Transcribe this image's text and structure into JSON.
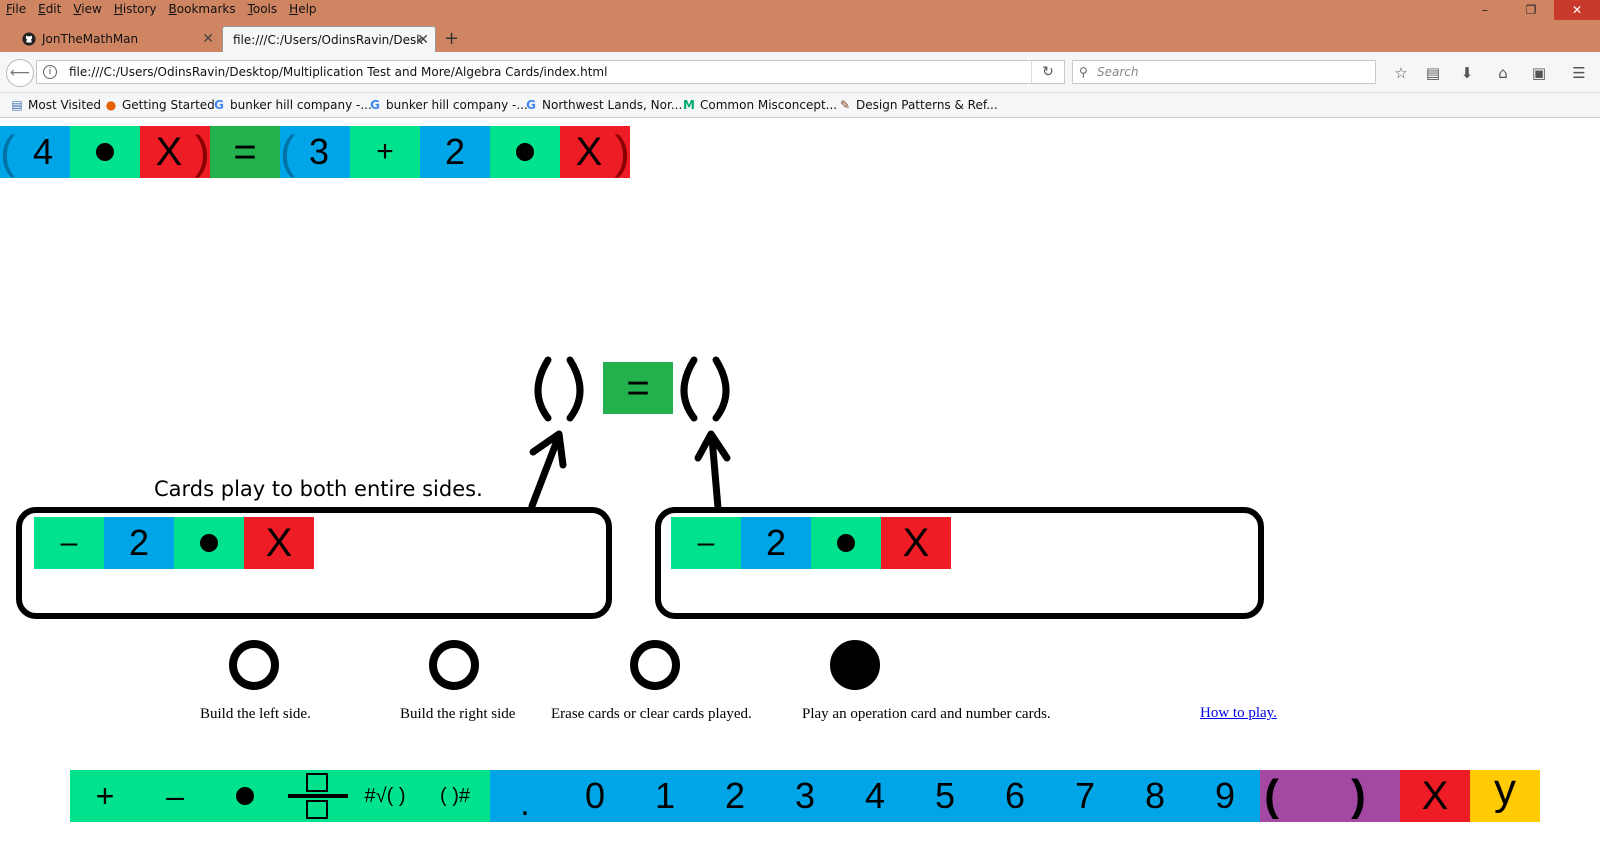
{
  "browser": {
    "menu": [
      "File",
      "Edit",
      "View",
      "History",
      "Bookmarks",
      "Tools",
      "Help"
    ],
    "window_controls": {
      "minimize": "–",
      "restore": "❐",
      "close": "✕"
    },
    "tabs": [
      {
        "label": "JonTheMathMan",
        "icon": "github-icon"
      },
      {
        "label": "file:///C:/Users/OdinsRavin/Desk",
        "icon": ""
      }
    ],
    "new_tab": "+",
    "url": "file:///C:/Users/OdinsRavin/Desktop/Multiplication Test and More/Algebra Cards/index.html",
    "search_placeholder": "Search",
    "bookmarks": [
      {
        "label": "Most Visited",
        "icon": "bookmark-folder-icon"
      },
      {
        "label": "Getting Started",
        "icon": "firefox-icon"
      },
      {
        "label": "bunker hill company -...",
        "icon": "google-icon"
      },
      {
        "label": "bunker hill company -...",
        "icon": "google-icon"
      },
      {
        "label": "Northwest Lands, Nor...",
        "icon": "google-icon"
      },
      {
        "label": "Common Misconcept...",
        "icon": "medium-icon"
      },
      {
        "label": "Design Patterns & Ref...",
        "icon": "design-icon"
      }
    ]
  },
  "equation_row": [
    {
      "text": "4",
      "color": "#00a5e8",
      "open_paren": true
    },
    {
      "text": "dot",
      "color": "#00e38c"
    },
    {
      "text": "X",
      "color": "#ee1c24",
      "close_paren": true
    },
    {
      "text": "=",
      "color": "#22b14c"
    },
    {
      "text": "3",
      "color": "#00a5e8",
      "open_paren": true
    },
    {
      "text": "+",
      "color": "#00e38c"
    },
    {
      "text": "2",
      "color": "#00a5e8"
    },
    {
      "text": "dot",
      "color": "#00e38c"
    },
    {
      "text": "X",
      "color": "#ee1c24",
      "close_paren": true
    }
  ],
  "center_equation": {
    "left": "( )",
    "equals": "=",
    "right": "( )"
  },
  "note": "Cards play to both entire sides.",
  "left_side_cards": [
    {
      "text": "–",
      "color": "#00e38c"
    },
    {
      "text": "2",
      "color": "#00a5e8"
    },
    {
      "text": "dot",
      "color": "#00e38c"
    },
    {
      "text": "X",
      "color": "#ee1c24"
    }
  ],
  "right_side_cards": [
    {
      "text": "–",
      "color": "#00e38c"
    },
    {
      "text": "2",
      "color": "#00a5e8"
    },
    {
      "text": "dot",
      "color": "#00e38c"
    },
    {
      "text": "X",
      "color": "#ee1c24"
    }
  ],
  "modes": [
    {
      "label": "Build the left side.",
      "selected": false
    },
    {
      "label": "Build the right side",
      "selected": false
    },
    {
      "label": "Erase cards or clear cards played.",
      "selected": false
    },
    {
      "label": "Play an operation card and number cards.",
      "selected": true
    }
  ],
  "how_to_play": "How to play.",
  "palette": {
    "operators": [
      "+",
      "–",
      "dot",
      "fraction",
      "#√( )",
      "( )#"
    ],
    "digits": [
      ".",
      "0",
      "1",
      "2",
      "3",
      "4",
      "5",
      "6",
      "7",
      "8",
      "9"
    ],
    "parens": "( )",
    "vars": [
      "X",
      "y"
    ],
    "colors": {
      "operators": "#00e38c",
      "digits": "#00a5e8",
      "parens": "#a349a4",
      "x": "#ee1c24",
      "y": "#ffcb05"
    }
  }
}
